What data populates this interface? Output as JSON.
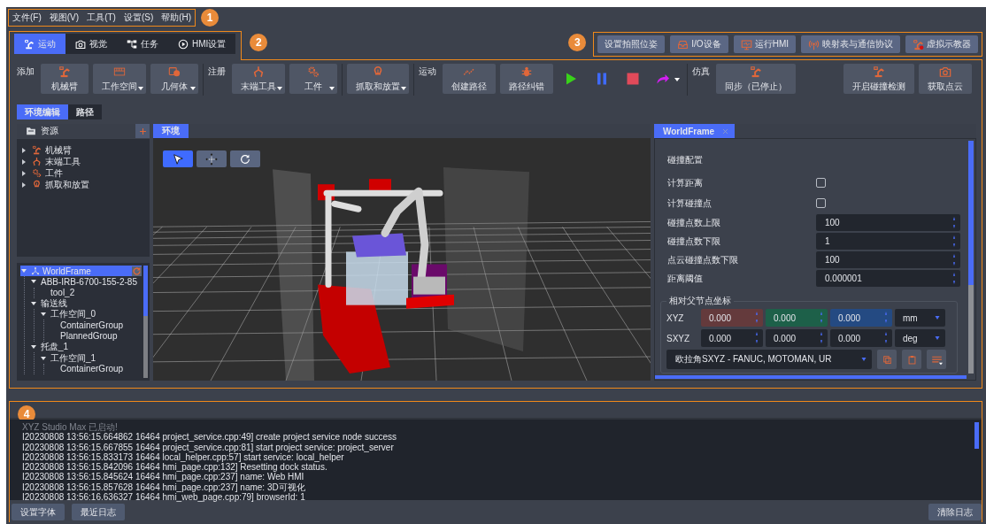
{
  "menu": [
    "文件(F)",
    "视图(V)",
    "工具(T)",
    "设置(S)",
    "帮助(H)"
  ],
  "callouts": [
    "1",
    "2",
    "3",
    "4"
  ],
  "mode_tabs": [
    {
      "label": "运动",
      "kind": "robot",
      "selected": true
    },
    {
      "label": "视觉",
      "kind": "camera",
      "selected": false
    },
    {
      "label": "任务",
      "kind": "tasks",
      "selected": false
    },
    {
      "label": "HMI设置",
      "kind": "hmi",
      "selected": false
    }
  ],
  "top_buttons": [
    {
      "label": "设置拍照位姿",
      "kind": "plain"
    },
    {
      "label": "I/O设备",
      "kind": "io"
    },
    {
      "label": "运行HMI",
      "kind": "monitor"
    },
    {
      "label": "映射表与通信协议",
      "kind": "antenna"
    },
    {
      "label": "虚拟示教器",
      "kind": "teach"
    }
  ],
  "toolbar": [
    {
      "label": "添加",
      "buttons": [
        {
          "label": "机械臂",
          "kind": "robot",
          "dropdown": false
        },
        {
          "label": "工作空间",
          "kind": "workspace",
          "dropdown": true
        },
        {
          "label": "几何体",
          "kind": "geometry",
          "dropdown": true
        }
      ]
    },
    {
      "label": "注册",
      "buttons": [
        {
          "label": "末端工具",
          "kind": "gripper",
          "dropdown": true
        },
        {
          "label": "工件",
          "kind": "gears",
          "dropdown": true
        }
      ]
    },
    {
      "buttons": [
        {
          "label": "抓取和放置",
          "kind": "pick",
          "dropdown": true
        }
      ]
    },
    {
      "label": "运动",
      "buttons": [
        {
          "label": "创建路径",
          "kind": "path",
          "dropdown": false
        },
        {
          "label": "路径纠错",
          "kind": "bug",
          "dropdown": false
        },
        {
          "kind": "play",
          "dropdown": false
        },
        {
          "kind": "pause",
          "dropdown": false
        },
        {
          "kind": "stop",
          "dropdown": false
        },
        {
          "kind": "redo",
          "dropdown": true
        }
      ]
    },
    {
      "label": "仿真",
      "buttons": [
        {
          "label": "同步（已停止）",
          "kind": "robot",
          "dropdown": false
        }
      ]
    },
    {
      "buttons": [
        {
          "label": "开启碰撞检测",
          "kind": "robot",
          "dropdown": false
        },
        {
          "label": "获取点云",
          "kind": "camera",
          "dropdown": false
        }
      ]
    }
  ],
  "sub_tabs": [
    {
      "label": "环境编辑",
      "selected": true
    },
    {
      "label": "路径",
      "selected": false
    }
  ],
  "resources": {
    "title": "资源",
    "items": [
      {
        "label": "机械臂",
        "kind": "robot",
        "expanded": false
      },
      {
        "label": "末端工具",
        "kind": "gripper",
        "expanded": false
      },
      {
        "label": "工件",
        "kind": "gears",
        "expanded": false
      },
      {
        "label": "抓取和放置",
        "kind": "pick",
        "expanded": false
      }
    ]
  },
  "scene_tree": [
    {
      "label": "WorldFrame",
      "kind": "frame",
      "selected": true,
      "expanded": true,
      "children": [
        {
          "label": "ABB-IRB-6700-155-2-85",
          "selected": false,
          "expanded": true,
          "children": [
            {
              "label": "tool_2",
              "selected": false
            }
          ]
        },
        {
          "label": "输送线",
          "selected": false,
          "expanded": true,
          "children": [
            {
              "label": "工作空间_0",
              "selected": false,
              "expanded": true,
              "children": [
                {
                  "label": "ContainerGroup",
                  "selected": false
                },
                {
                  "label": "PlannedGroup",
                  "selected": false
                }
              ]
            }
          ]
        },
        {
          "label": "托盘_1",
          "selected": false,
          "expanded": true,
          "children": [
            {
              "label": "工作空间_1",
              "selected": false,
              "expanded": true,
              "children": [
                {
                  "label": "ContainerGroup",
                  "selected": false
                }
              ]
            }
          ]
        }
      ]
    }
  ],
  "viewport": {
    "tab": "环境",
    "tools": [
      {
        "kind": "select",
        "selected": true
      },
      {
        "kind": "move",
        "selected": false
      },
      {
        "kind": "rotate",
        "selected": false
      }
    ]
  },
  "properties": {
    "tab": "WorldFrame",
    "section": "碰撞配置",
    "checks": [
      {
        "label": "计算距离",
        "checked": false
      },
      {
        "label": "计算碰撞点",
        "checked": false
      }
    ],
    "spins": [
      {
        "label": "碰撞点数上限",
        "value": "100"
      },
      {
        "label": "碰撞点数下限",
        "value": "1"
      },
      {
        "label": "点云碰撞点数下限",
        "value": "100"
      },
      {
        "label": "距离阈值",
        "value": "0.000001"
      }
    ],
    "coords": {
      "title": "相对父节点坐标",
      "rows": [
        {
          "label": "XYZ",
          "values": [
            {
              "value": "0.000",
              "color": "#643a3c"
            },
            {
              "value": "0.000",
              "color": "#1d6049"
            },
            {
              "value": "0.000",
              "color": "#244a82"
            }
          ],
          "unit": "mm"
        },
        {
          "label": "SXYZ",
          "values": [
            {
              "value": "0.000"
            },
            {
              "value": "0.000"
            },
            {
              "value": "0.000"
            }
          ],
          "unit": "deg"
        }
      ],
      "convention": "欧拉角SXYZ - FANUC, MOTOMAN, UR"
    }
  },
  "log": {
    "lines": [
      {
        "kind": "notice",
        "text": "XYZ Studio Max 已启动!"
      },
      {
        "kind": "info",
        "text": "I20230808 13:56:15.664862 16464 project_service.cpp:49] create project service node success"
      },
      {
        "kind": "info",
        "text": "I20230808 13:56:15.667855 16464 project_service.cpp:81] start project service: project_server"
      },
      {
        "kind": "info",
        "text": "I20230808 13:56:15.833173 16464 local_helper.cpp:57] start service: local_helper"
      },
      {
        "kind": "info",
        "text": "I20230808 13:56:15.842096 16464 hmi_page.cpp:132] Resetting dock status."
      },
      {
        "kind": "info",
        "text": "I20230808 13:56:15.845624 16464 hmi_page.cpp:237] name: Web HMI"
      },
      {
        "kind": "info",
        "text": "I20230808 13:56:15.857628 16464 hmi_page.cpp:237] name: 3D可视化"
      },
      {
        "kind": "info",
        "text": "I20230808 13:56:16.636327 16464 hmi_web_page.cpp:79] browserId: 1"
      }
    ],
    "buttons": [
      "设置字体",
      "最近日志"
    ],
    "clear_button": "清除日志"
  }
}
